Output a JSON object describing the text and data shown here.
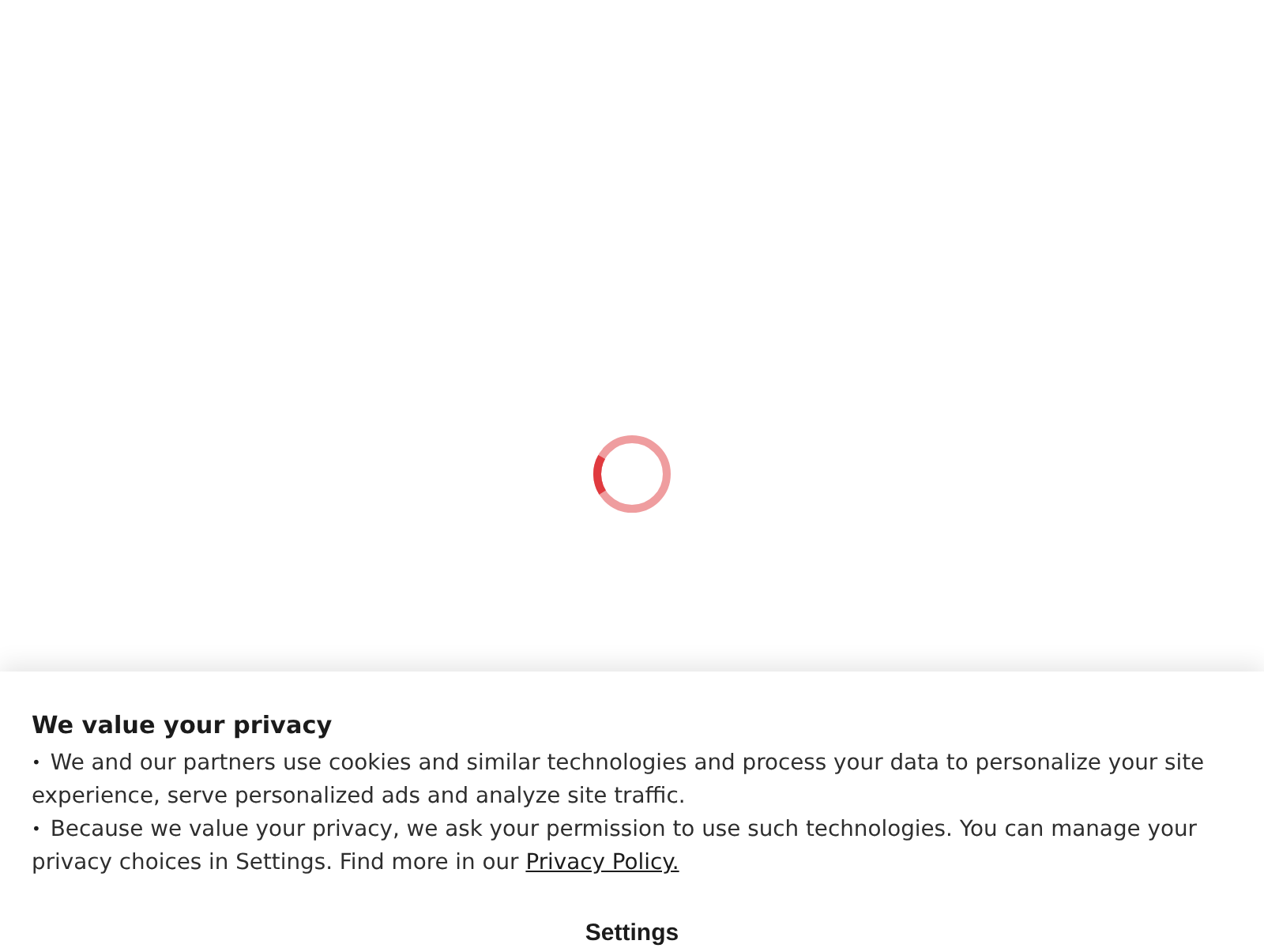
{
  "banner": {
    "title": "We value your privacy",
    "items": [
      {
        "bullet": "•",
        "text": "We and our partners use cookies and similar technologies and process your data to personalize your site experience, serve personalized ads and analyze site traffic."
      },
      {
        "bullet": "•",
        "text": "Because we value your privacy, we ask your permission to use such technologies. You can manage your privacy choices in Settings. Find more in our ",
        "link": "Privacy Policy."
      }
    ],
    "buttons": [
      {
        "label": "Settings"
      }
    ]
  }
}
